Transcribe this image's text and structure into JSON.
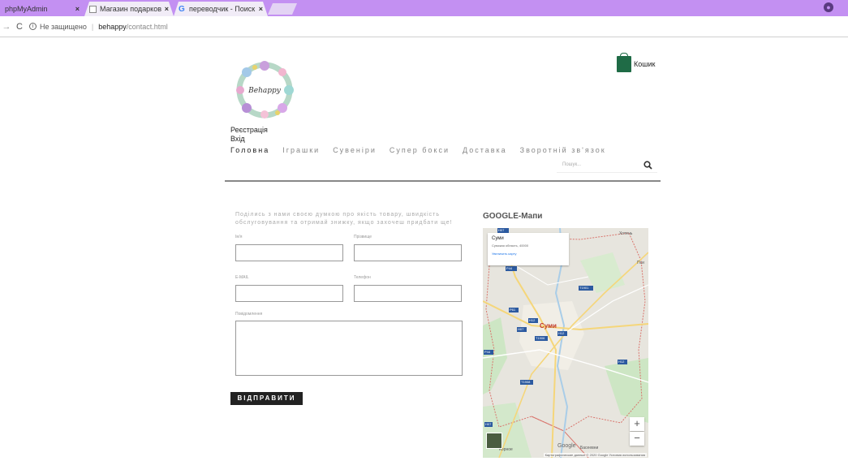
{
  "browser": {
    "tabs": [
      {
        "label": "phpMyAdmin",
        "close": "×"
      },
      {
        "label": "Магазин подарков",
        "close": "×"
      },
      {
        "label": "переводчик - Поиск в Г",
        "close": "×"
      }
    ],
    "address": {
      "security": "Не защищено",
      "separator": "|",
      "host": "behappy",
      "path": "/contact.html"
    },
    "nav_back": "←",
    "nav_forward": "→",
    "nav_reload": "C",
    "info_glyph": "i",
    "profile_glyph": "●"
  },
  "header": {
    "logo_text": "Behappy",
    "cart_label": "Кошик",
    "auth": {
      "register": "Реєстрація",
      "login": "Вхід"
    },
    "nav": [
      {
        "label": "Головна",
        "active": true
      },
      {
        "label": "Іграшки",
        "active": false
      },
      {
        "label": "Сувеніри",
        "active": false
      },
      {
        "label": "Супер бокси",
        "active": false
      },
      {
        "label": "Доставка",
        "active": false
      },
      {
        "label": "Зворотній зв'язок",
        "active": false
      }
    ],
    "search_placeholder": "Пошук..."
  },
  "contact": {
    "intro_line1": "Поділись з нами своєю думкою про якість товару, швидкість",
    "intro_line2": "обслуговування та отримай знижку, якщо захочеш придбати ще!",
    "fields": {
      "name_label": "Ім'я",
      "surname_label": "Прізвище",
      "email_label": "E-MAIL",
      "phone_label": "Телефон",
      "message_label": "Повідомлення"
    },
    "submit_label": "ВІДПРАВИТИ"
  },
  "map": {
    "title": "GOOGLE-Мапи",
    "card": {
      "title": "Суми",
      "address": "Сумская область, 40000",
      "link": "Увеличить карту"
    },
    "city": "Суми",
    "labels": {
      "top_right": "Хотень",
      "right": "Пси",
      "bottom_left": "Корное",
      "bottom_right": "Басеевни",
      "google": "Google"
    },
    "road_labels": [
      "H07",
      "P44",
      "H07",
      "T1901",
      "P61",
      "H12",
      "T1906",
      "H12",
      "P44",
      "H07",
      "T1908",
      "H12"
    ],
    "zoom_in": "+",
    "zoom_out": "−",
    "attribution": "Картографические данные © 2020 Google  Условия использования"
  },
  "colors": {
    "tab_bar": "#c390f2",
    "submit_bg": "#222222",
    "city_red": "#c0392b",
    "cart_green": "#1f6b46"
  }
}
